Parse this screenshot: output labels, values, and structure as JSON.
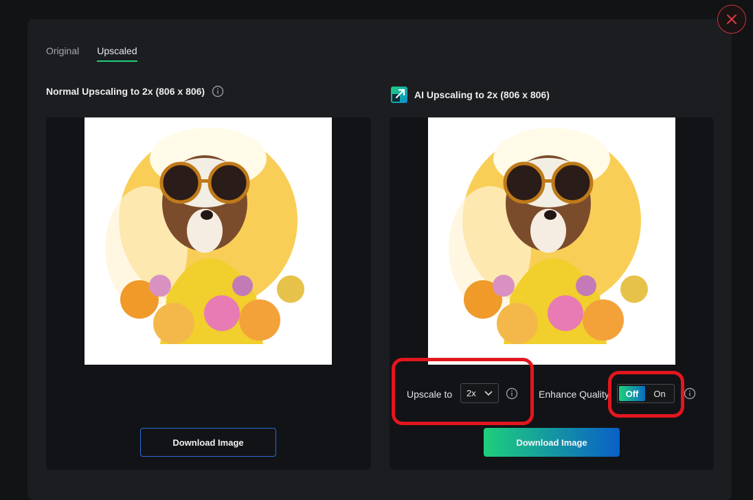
{
  "tabs": [
    {
      "label": "Original",
      "active": false
    },
    {
      "label": "Upscaled",
      "active": true
    }
  ],
  "left_panel": {
    "title": "Normal Upscaling to 2x (806 x 806)",
    "download_label": "Download Image"
  },
  "right_panel": {
    "title": "AI Upscaling to 2x (806 x 806)",
    "upscale_label": "Upscale to",
    "upscale_value": "2x",
    "enhance_label": "Enhance Quality",
    "toggle_off": "Off",
    "toggle_on": "On",
    "download_label": "Download Image"
  },
  "icons": {
    "close": "close-icon",
    "info": "info-icon",
    "ai": "ai-upscale-icon",
    "dropdown": "chevron-down-icon"
  },
  "colors": {
    "accent_green": "#1fcf7c",
    "accent_blue": "#0a5fc7",
    "highlight_red": "#e3161e",
    "close_red": "#c9353b"
  }
}
